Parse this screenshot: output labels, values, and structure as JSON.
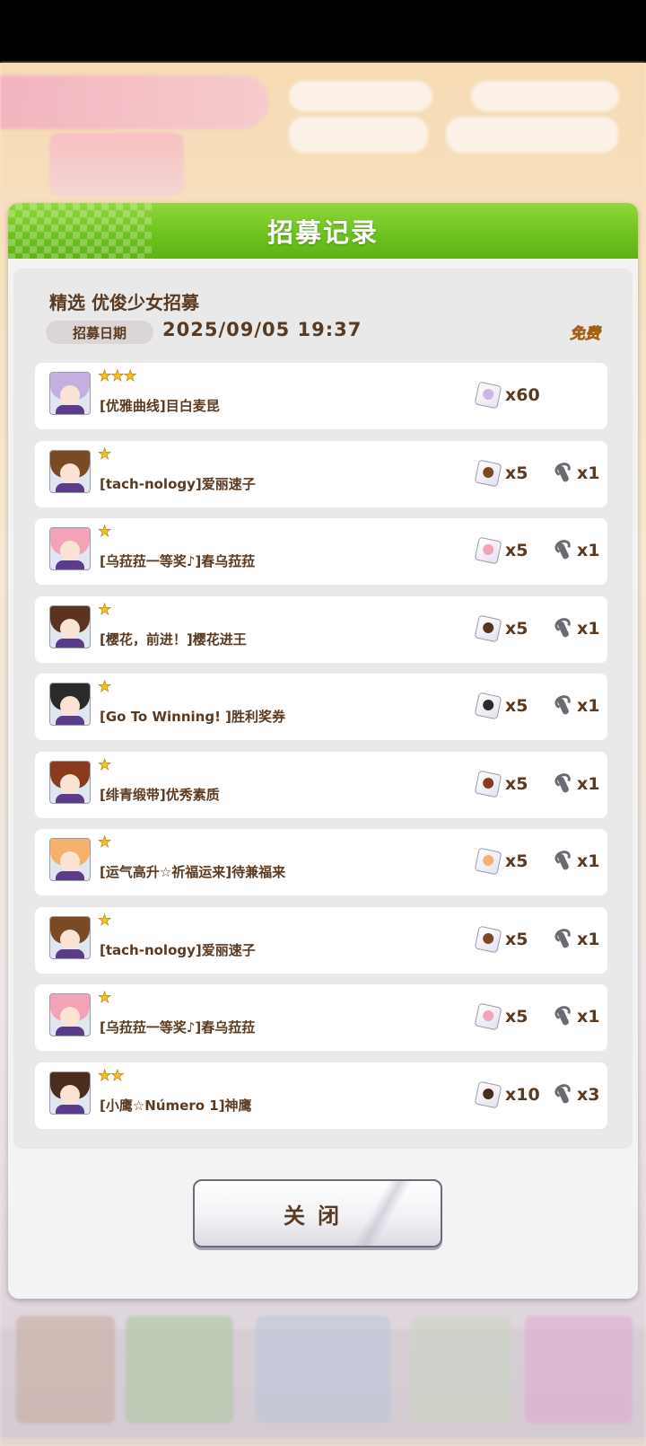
{
  "dialog": {
    "title": "招募记录",
    "banner_name": "精选 优俊少女招募",
    "date_label": "招募日期",
    "date_value": "2025/09/05 19:37",
    "cost_badge": "免费",
    "close_label": "关闭"
  },
  "results": [
    {
      "stars": "★★★",
      "name": "[优雅曲线]目白麦昆",
      "hair_color": "#c4b0e0",
      "piece_count": "x60",
      "show_wrench": false,
      "item_count": ""
    },
    {
      "stars": "★",
      "name": "[tach-nology]爱丽速子",
      "hair_color": "#7a4a24",
      "piece_count": "x5",
      "show_wrench": true,
      "item_count": "x1"
    },
    {
      "stars": "★",
      "name": "[乌菈菈一等奖♪]春乌菈菈",
      "hair_color": "#f3a2b8",
      "piece_count": "x5",
      "show_wrench": true,
      "item_count": "x1"
    },
    {
      "stars": "★",
      "name": "[樱花，前进！]樱花进王",
      "hair_color": "#5a3420",
      "piece_count": "x5",
      "show_wrench": true,
      "item_count": "x1"
    },
    {
      "stars": "★",
      "name": "[Go To Winning! ]胜利奖券",
      "hair_color": "#2a2a2a",
      "piece_count": "x5",
      "show_wrench": true,
      "item_count": "x1"
    },
    {
      "stars": "★",
      "name": "[绯青缎带]优秀素质",
      "hair_color": "#8a3b1e",
      "piece_count": "x5",
      "show_wrench": true,
      "item_count": "x1"
    },
    {
      "stars": "★",
      "name": "[运气高升☆祈福运来]待兼福来",
      "hair_color": "#f5b06a",
      "piece_count": "x5",
      "show_wrench": true,
      "item_count": "x1"
    },
    {
      "stars": "★",
      "name": "[tach-nology]爱丽速子",
      "hair_color": "#7a4a24",
      "piece_count": "x5",
      "show_wrench": true,
      "item_count": "x1"
    },
    {
      "stars": "★",
      "name": "[乌菈菈一等奖♪]春乌菈菈",
      "hair_color": "#f3a2b8",
      "piece_count": "x5",
      "show_wrench": true,
      "item_count": "x1"
    },
    {
      "stars": "★★",
      "name": "[小鹰☆Número 1]神鹰",
      "hair_color": "#4a2d1c",
      "piece_count": "x10",
      "show_wrench": true,
      "item_count": "x3"
    }
  ],
  "colors": {
    "header_green": "#6dc11e",
    "text_brown": "#5a3a21",
    "star_yellow": "#f6c21a",
    "free_orange": "#f4b22a"
  },
  "icons": {
    "piece": "character-piece-icon",
    "item": "wrench-item-icon",
    "star": "star-icon"
  }
}
